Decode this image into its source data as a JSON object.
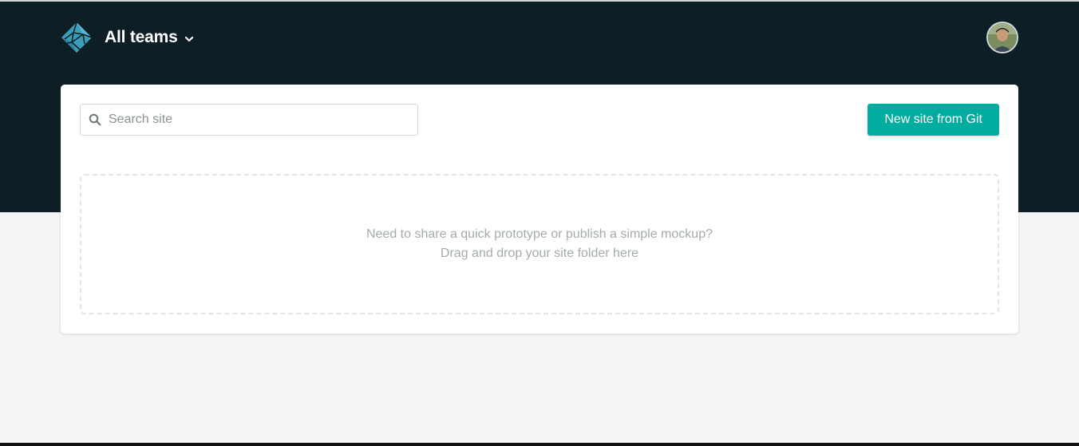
{
  "header": {
    "team_label": "All teams",
    "logo_icon": "netlify-logo-icon",
    "chevron_icon": "chevron-down-icon",
    "avatar_icon": "user-avatar-icon"
  },
  "toolbar": {
    "search_placeholder": "Search site",
    "search_value": "",
    "search_icon": "search-icon",
    "new_site_label": "New site from Git"
  },
  "dropzone": {
    "line1": "Need to share a quick prototype or publish a simple mockup?",
    "line2": "Drag and drop your site folder here"
  },
  "colors": {
    "header_bg": "#0e1e25",
    "page_bg": "#f3f5f6",
    "accent": "#00ad9f",
    "logo_teal": "#3a9ebb"
  }
}
